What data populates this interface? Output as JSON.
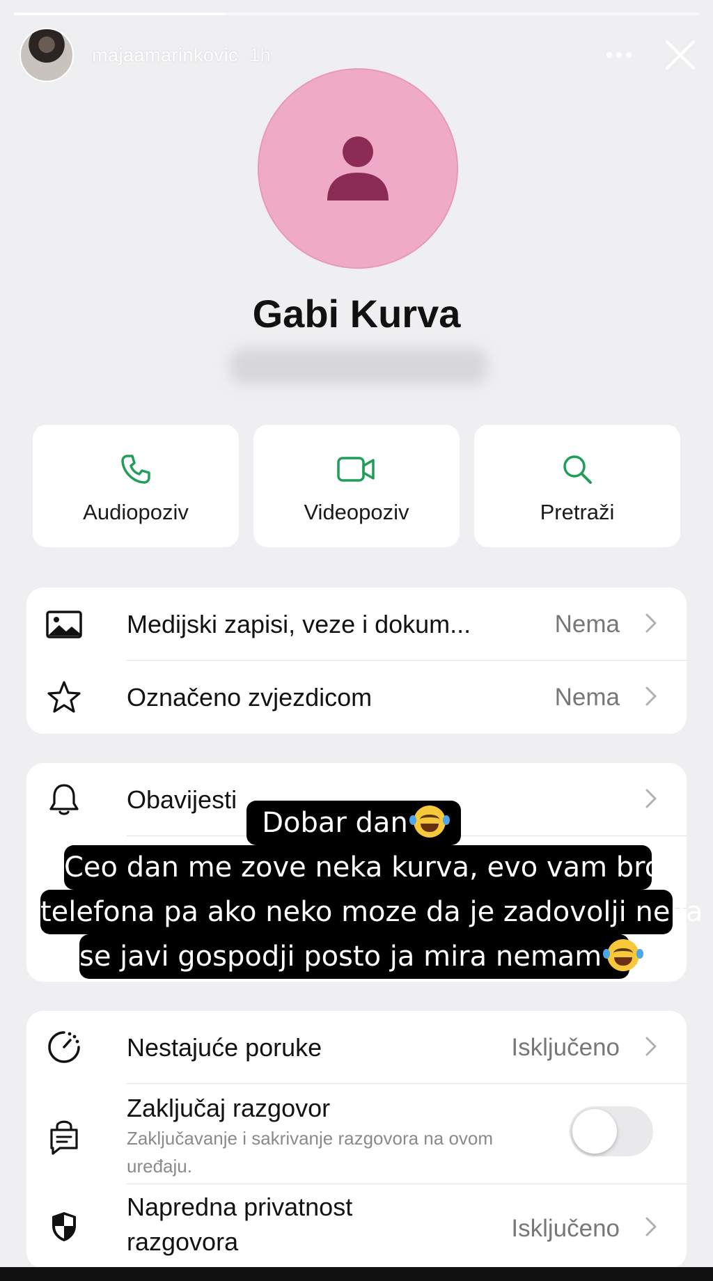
{
  "story": {
    "username": "majaamarinkovic",
    "time": "1h",
    "progress": 0.31
  },
  "contact": {
    "name": "Gabi Kurva"
  },
  "actions": [
    {
      "label": "Audiopoziv",
      "icon": "phone-icon"
    },
    {
      "label": "Videopoziv",
      "icon": "video-camera-icon"
    },
    {
      "label": "Pretraži",
      "icon": "search-icon"
    }
  ],
  "media_card": {
    "media": {
      "title": "Medijski zapisi, veze i dokum...",
      "value": "Nema",
      "icon": "image-icon"
    },
    "starred": {
      "title": "Označeno zvjezdicom",
      "value": "Nema",
      "icon": "star-icon"
    }
  },
  "notify_card": {
    "notifications": {
      "title": "Obavijesti",
      "icon": "bell-icon"
    }
  },
  "privacy_card": {
    "disappearing": {
      "title": "Nestajuće poruke",
      "value": "Isključeno",
      "icon": "timer-icon"
    },
    "lock": {
      "title": "Zaključaj razgovor",
      "subtitle": "Zaključavanje i sakrivanje razgovora na ovom uređaju.",
      "icon": "lock-chat-icon",
      "enabled": false
    },
    "advanced": {
      "title_line1": "Napredna privatnost",
      "title_line2": "razgovora",
      "value": "Isključeno",
      "icon": "shield-icon"
    }
  },
  "caption": {
    "line1": "Dobar dan",
    "line2": "Ceo dan me zove neka kurva, evo vam broj",
    "line3": "telefona pa ako neko moze da je zadovolji neka",
    "line4": "se javi gospodji posto ja mira nemam",
    "emoji": "face-with-tears-of-joy"
  },
  "colors": {
    "accent_green": "#1f9e5a",
    "avatar_pink": "#efabc5",
    "avatar_figure": "#8b2c55"
  }
}
